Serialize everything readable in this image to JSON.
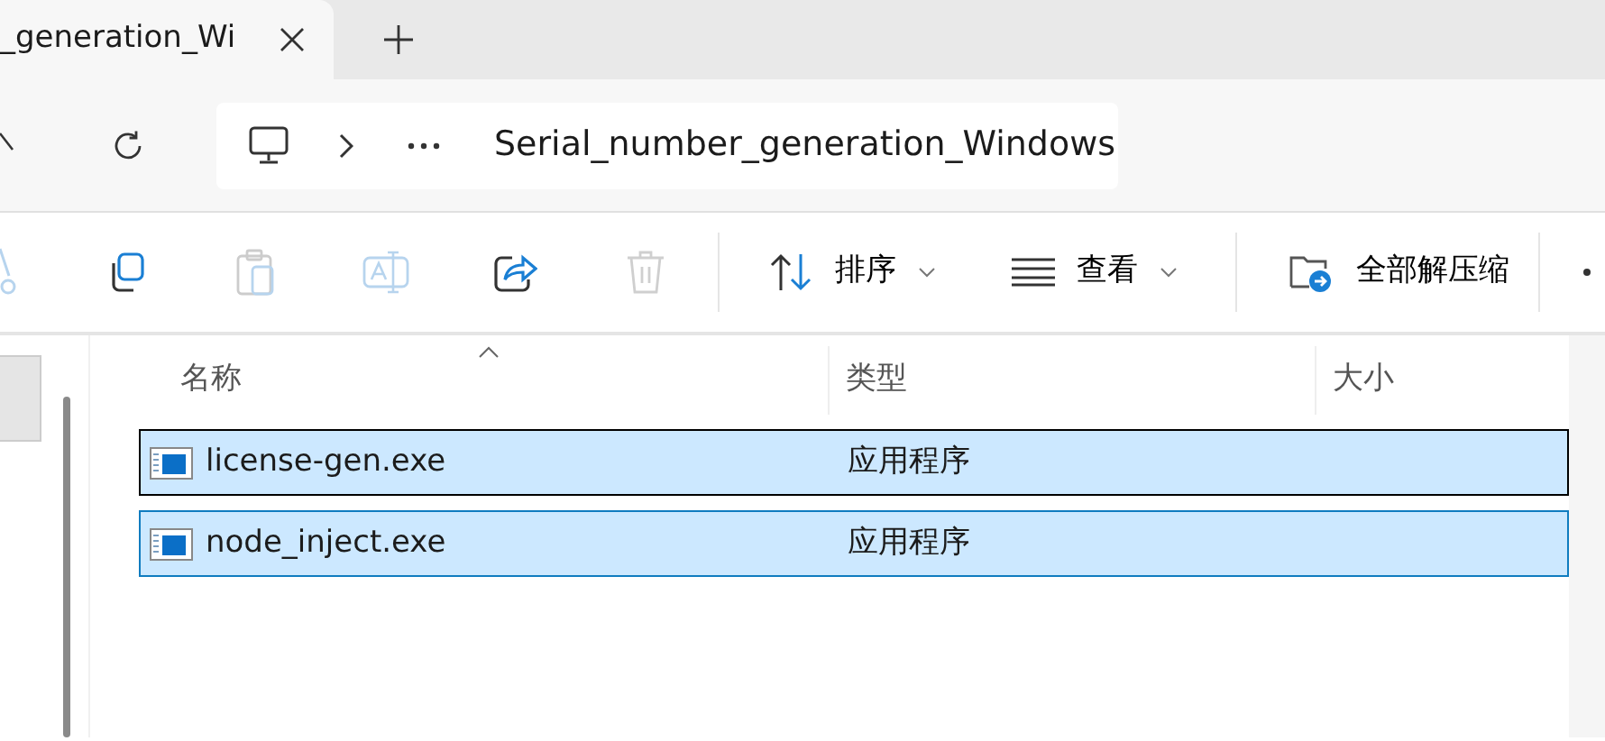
{
  "tab": {
    "title": "_generation_Wi",
    "selected": true
  },
  "address": {
    "folder": "Serial_number_generation_Windows"
  },
  "toolbar": {
    "actions": [
      {
        "kind": "cut",
        "disabled": true
      },
      {
        "kind": "copy",
        "disabled": false
      },
      {
        "kind": "paste",
        "disabled": true
      },
      {
        "kind": "rename",
        "disabled": true
      },
      {
        "kind": "share",
        "disabled": false
      },
      {
        "kind": "delete",
        "disabled": true
      }
    ],
    "menus": [
      {
        "kind": "sort",
        "label": "排序"
      },
      {
        "kind": "view",
        "label": "查看"
      }
    ],
    "extract": {
      "label": "全部解压缩"
    }
  },
  "table": {
    "columns": [
      {
        "label": "名称",
        "sorted": true
      },
      {
        "label": "类型",
        "sorted": false
      },
      {
        "label": "大小",
        "sorted": false
      }
    ],
    "rows": [
      {
        "name": "license-gen.exe",
        "type": "应用程序",
        "selected": true,
        "focused": true
      },
      {
        "name": "node_inject.exe",
        "type": "应用程序",
        "selected": true,
        "focused": false
      }
    ]
  }
}
